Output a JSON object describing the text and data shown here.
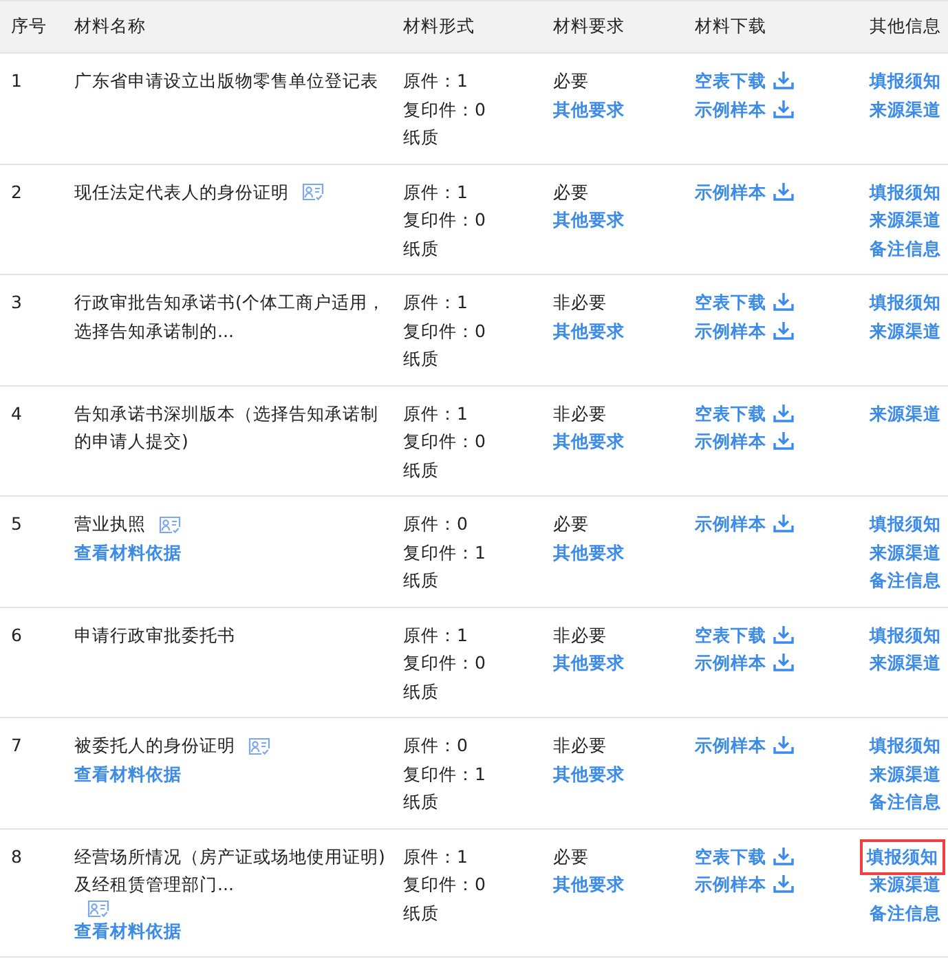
{
  "table": {
    "columns": [
      "序号",
      "材料名称",
      "材料形式",
      "材料要求",
      "材料下载",
      "其他信息"
    ],
    "rows": [
      {
        "no": "1",
        "name_lines": [
          "广东省申请设立出版物零售单位登记表"
        ],
        "id_icon": false,
        "form": [
          "原件：1",
          "复印件：0",
          "纸质"
        ],
        "requirement": "必要",
        "requirement_link": "其他要求",
        "downloads": [
          "空表下载",
          "示例样本"
        ],
        "other": [
          {
            "text": "填报须知",
            "highlighted": false
          },
          {
            "text": "来源渠道",
            "highlighted": false
          }
        ]
      },
      {
        "no": "2",
        "name_lines": [
          "现任法定代表人的身份证明"
        ],
        "id_icon": true,
        "form": [
          "原件：1",
          "复印件：0",
          "纸质"
        ],
        "requirement": "必要",
        "requirement_link": "其他要求",
        "downloads": [
          "示例样本"
        ],
        "other": [
          {
            "text": "填报须知",
            "highlighted": false
          },
          {
            "text": "来源渠道",
            "highlighted": false
          },
          {
            "text": "备注信息",
            "highlighted": false
          }
        ]
      },
      {
        "no": "3",
        "name_lines": [
          "行政审批告知承诺书(个体工商户适用，",
          "选择告知承诺制的..."
        ],
        "id_icon": false,
        "form": [
          "原件：1",
          "复印件：0",
          "纸质"
        ],
        "requirement": "非必要",
        "requirement_link": "其他要求",
        "downloads": [
          "空表下载",
          "示例样本"
        ],
        "other": [
          {
            "text": "填报须知",
            "highlighted": false
          },
          {
            "text": "来源渠道",
            "highlighted": false
          }
        ]
      },
      {
        "no": "4",
        "name_lines": [
          "告知承诺书深圳版本（选择告知承诺制",
          "的申请人提交)"
        ],
        "id_icon": false,
        "form": [
          "原件：1",
          "复印件：0",
          "纸质"
        ],
        "requirement": "非必要",
        "requirement_link": "其他要求",
        "downloads": [
          "空表下载",
          "示例样本"
        ],
        "other": [
          {
            "text": "来源渠道",
            "highlighted": false
          }
        ]
      },
      {
        "no": "5",
        "name_lines": [
          "营业执照"
        ],
        "id_icon": true,
        "basis_link": "查看材料依据",
        "form": [
          "原件：0",
          "复印件：1",
          "纸质"
        ],
        "requirement": "必要",
        "requirement_link": "其他要求",
        "downloads": [
          "示例样本"
        ],
        "other": [
          {
            "text": "填报须知",
            "highlighted": false
          },
          {
            "text": "来源渠道",
            "highlighted": false
          },
          {
            "text": "备注信息",
            "highlighted": false
          }
        ]
      },
      {
        "no": "6",
        "name_lines": [
          "申请行政审批委托书"
        ],
        "id_icon": false,
        "form": [
          "原件：1",
          "复印件：0",
          "纸质"
        ],
        "requirement": "非必要",
        "requirement_link": "其他要求",
        "downloads": [
          "空表下载",
          "示例样本"
        ],
        "other": [
          {
            "text": "填报须知",
            "highlighted": false
          },
          {
            "text": "来源渠道",
            "highlighted": false
          }
        ]
      },
      {
        "no": "7",
        "name_lines": [
          "被委托人的身份证明"
        ],
        "id_icon": true,
        "basis_link": "查看材料依据",
        "form": [
          "原件：0",
          "复印件：1",
          "纸质"
        ],
        "requirement": "非必要",
        "requirement_link": "其他要求",
        "downloads": [
          "示例样本"
        ],
        "other": [
          {
            "text": "填报须知",
            "highlighted": false
          },
          {
            "text": "来源渠道",
            "highlighted": false
          },
          {
            "text": "备注信息",
            "highlighted": false
          }
        ]
      },
      {
        "no": "8",
        "name_lines": [
          "经营场所情况（房产证或场地使用证明)",
          "及经租赁管理部门..."
        ],
        "id_icon": true,
        "basis_link": "查看材料依据",
        "form": [
          "原件：1",
          "复印件：0",
          "纸质"
        ],
        "requirement": "必要",
        "requirement_link": "其他要求",
        "downloads": [
          "空表下载",
          "示例样本"
        ],
        "other": [
          {
            "text": "填报须知",
            "highlighted": true
          },
          {
            "text": "来源渠道",
            "highlighted": false
          },
          {
            "text": "备注信息",
            "highlighted": false
          }
        ]
      }
    ]
  }
}
